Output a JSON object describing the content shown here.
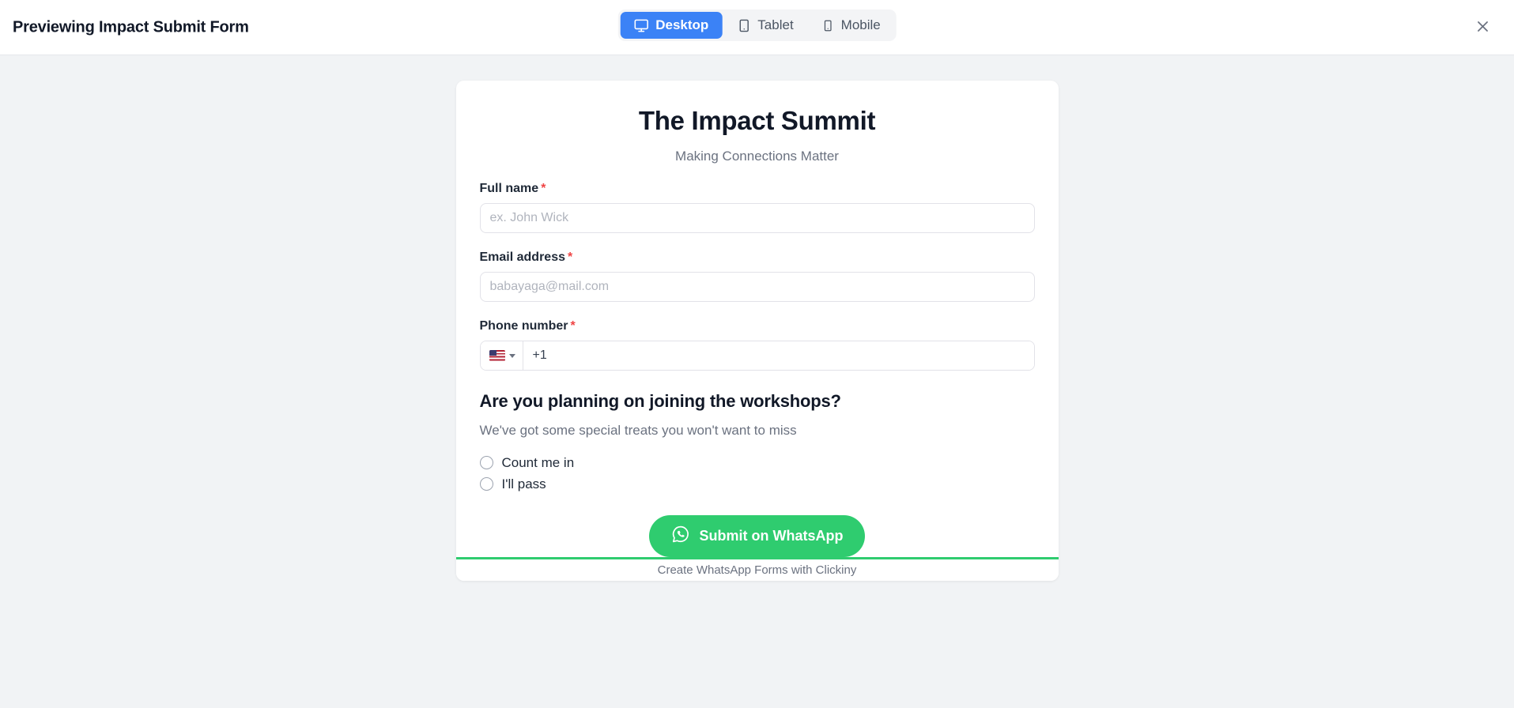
{
  "header": {
    "title": "Previewing Impact Submit Form",
    "device_tabs": [
      {
        "label": "Desktop",
        "icon": "monitor-icon",
        "active": true
      },
      {
        "label": "Tablet",
        "icon": "tablet-icon",
        "active": false
      },
      {
        "label": "Mobile",
        "icon": "mobile-icon",
        "active": false
      }
    ],
    "close_icon": "close-icon",
    "active_tab_color": "#3b82f6"
  },
  "form": {
    "title": "The Impact Summit",
    "subtitle": "Making Connections Matter",
    "fields": [
      {
        "label": "Full name",
        "required_marker": "*",
        "placeholder": "ex. John Wick",
        "value": ""
      },
      {
        "label": "Email address",
        "required_marker": "*",
        "placeholder": "babayaga@mail.com",
        "value": ""
      }
    ],
    "phone": {
      "label": "Phone number",
      "required_marker": "*",
      "country_flag": "us-flag-icon",
      "dial_code": "+1",
      "placeholder": ""
    },
    "question": {
      "title": "Are you planning on joining the workshops?",
      "description": "We've got some special treats you won't want to miss",
      "options": [
        {
          "label": "Count me in",
          "selected": false
        },
        {
          "label": "I'll pass",
          "selected": false
        }
      ]
    },
    "submit": {
      "label": "Submit on WhatsApp",
      "icon": "whatsapp-icon",
      "color": "#2fcc6f"
    },
    "footer": {
      "text": "Create WhatsApp Forms with Clickiny",
      "accent_color": "#2fcc6f"
    }
  }
}
